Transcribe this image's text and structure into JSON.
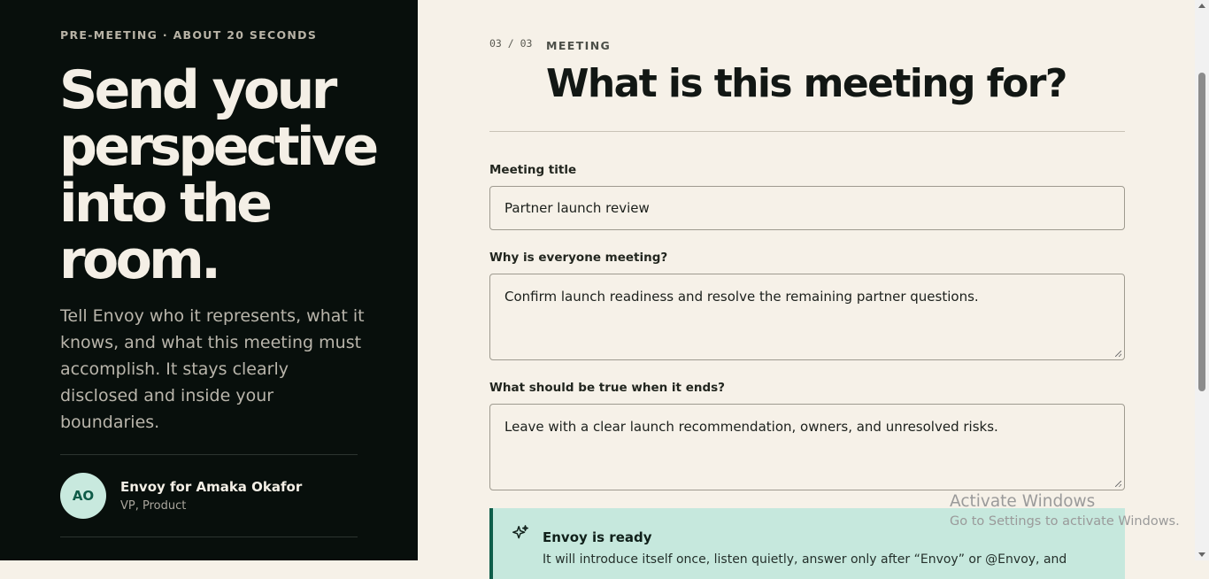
{
  "left_panel": {
    "eyebrow": "PRE-MEETING · ABOUT 20 SECONDS",
    "headline": "Send your perspective into the room.",
    "description": "Tell Envoy who it represents, what it knows, and what this meeting must accomplish. It stays clearly disclosed and inside your boundaries.",
    "profile": {
      "initials": "AO",
      "name": "Envoy for Amaka Okafor",
      "role": "VP, Product"
    }
  },
  "form": {
    "step": "03 / 03",
    "section": "MEETING",
    "title": "What is this meeting for?",
    "fields": {
      "meeting_title": {
        "label": "Meeting title",
        "value": "Partner launch review"
      },
      "why_meeting": {
        "label": "Why is everyone meeting?",
        "value": "Confirm launch readiness and resolve the remaining partner questions."
      },
      "outcome": {
        "label": "What should be true when it ends?",
        "value": "Leave with a clear launch recommendation, owners, and unresolved risks."
      }
    },
    "ready_notice": {
      "icon": "sparkle-icon",
      "title": "Envoy is ready",
      "body": "It will introduce itself once, listen quietly, answer only after “Envoy” or @Envoy, and"
    }
  },
  "watermark": {
    "line1": "Activate Windows",
    "line2": "Go to Settings to activate Windows."
  },
  "colors": {
    "left_bg": "#080f0c",
    "right_bg": "#f6f1e8",
    "accent": "#0e5e4a",
    "notice_bg": "#c6e8dd"
  }
}
